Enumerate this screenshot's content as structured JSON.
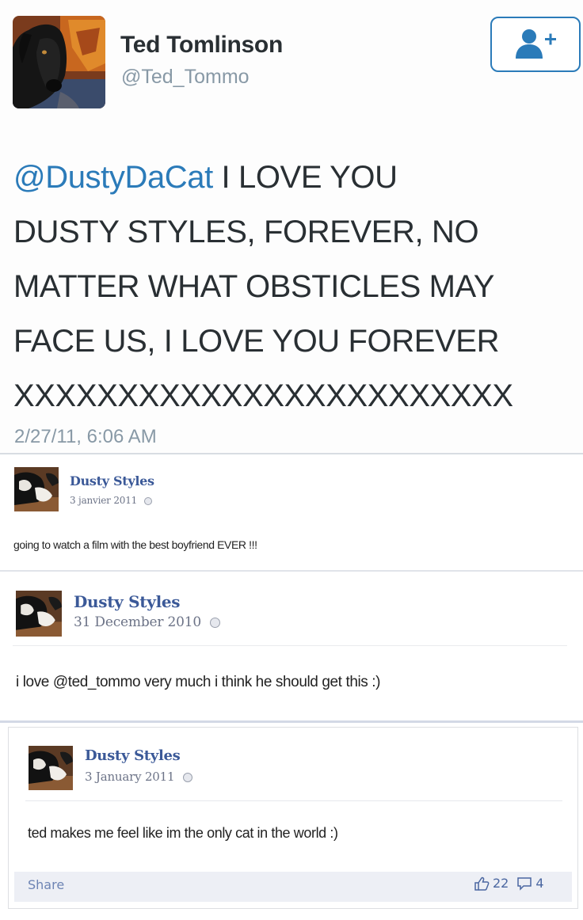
{
  "tweet": {
    "name": "Ted Tomlinson",
    "handle": "@Ted_Tommo",
    "follow_icon": "follow-user-plus-icon",
    "mention": "@DustyDaCat",
    "text_line1": " I LOVE YOU",
    "text_line2": "DUSTY STYLES, FOREVER, NO",
    "text_line3": "MATTER WHAT OBSTICLES MAY",
    "text_line4": "FACE US, I LOVE YOU FOREVER",
    "text_line5": "XXXXXXXXXXXXXXXXXXXXXXXX",
    "timestamp": "2/27/11, 6:06 AM",
    "accent_color": "#2b7bb9"
  },
  "posts": [
    {
      "author": "Dusty Styles",
      "date": "3 janvier 2011",
      "message": "going to watch a film with the best boyfriend EVER !!!"
    },
    {
      "author": "Dusty Styles",
      "date": "31 December 2010",
      "message": "i love @ted_tommo very much i think he should get this :)"
    },
    {
      "author": "Dusty Styles",
      "date": "3 January 2011",
      "message": "ted makes me feel like im the only cat in the world :)",
      "share_label": "Share",
      "like_count": "22",
      "comment_count": "4"
    }
  ],
  "colors": {
    "facebook_name": "#3b5998",
    "meta_gray": "#8899a6"
  }
}
